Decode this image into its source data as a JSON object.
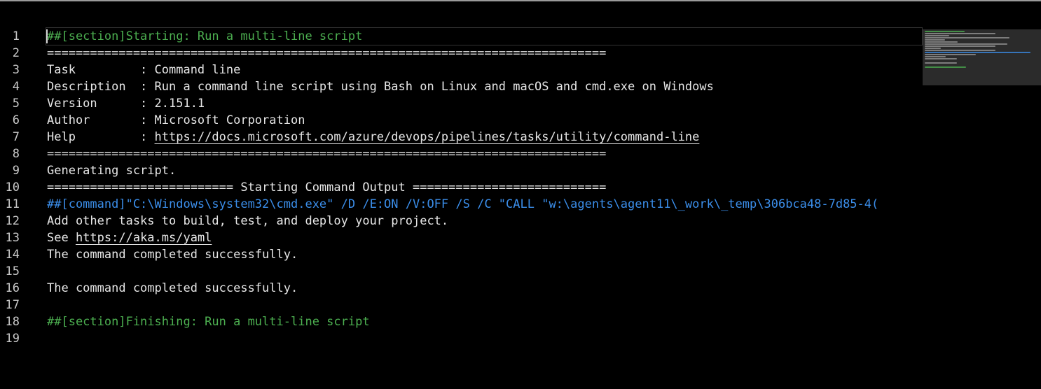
{
  "log": {
    "lines": [
      {
        "number": "1",
        "kind": "section",
        "text": "##[section]Starting: Run a multi-line script"
      },
      {
        "number": "2",
        "kind": "plain",
        "text": "=============================================================================="
      },
      {
        "number": "3",
        "kind": "plain",
        "text": "Task         : Command line"
      },
      {
        "number": "4",
        "kind": "plain",
        "text": "Description  : Run a command line script using Bash on Linux and macOS and cmd.exe on Windows"
      },
      {
        "number": "5",
        "kind": "plain",
        "text": "Version      : 2.151.1"
      },
      {
        "number": "6",
        "kind": "plain",
        "text": "Author       : Microsoft Corporation"
      },
      {
        "number": "7",
        "kind": "link-line",
        "prefix": "Help         : ",
        "link": "https://docs.microsoft.com/azure/devops/pipelines/tasks/utility/command-line"
      },
      {
        "number": "8",
        "kind": "plain",
        "text": "=============================================================================="
      },
      {
        "number": "9",
        "kind": "plain",
        "text": "Generating script."
      },
      {
        "number": "10",
        "kind": "plain",
        "text": "========================== Starting Command Output ==========================="
      },
      {
        "number": "11",
        "kind": "command",
        "text": "##[command]\"C:\\Windows\\system32\\cmd.exe\" /D /E:ON /V:OFF /S /C \"CALL \"w:\\agents\\agent11\\_work\\_temp\\306bca48-7d85-4("
      },
      {
        "number": "12",
        "kind": "plain",
        "text": "Add other tasks to build, test, and deploy your project."
      },
      {
        "number": "13",
        "kind": "link-line",
        "prefix": "See ",
        "link": "https://aka.ms/yaml"
      },
      {
        "number": "14",
        "kind": "plain",
        "text": "The command completed successfully."
      },
      {
        "number": "15",
        "kind": "plain",
        "text": ""
      },
      {
        "number": "16",
        "kind": "plain",
        "text": "The command completed successfully."
      },
      {
        "number": "17",
        "kind": "plain",
        "text": ""
      },
      {
        "number": "18",
        "kind": "section",
        "text": "##[section]Finishing: Run a multi-line script"
      },
      {
        "number": "19",
        "kind": "plain",
        "text": ""
      }
    ]
  },
  "colors": {
    "background": "#000000",
    "section": "#4caf50",
    "command": "#3b8eea",
    "text": "#e6e6e6",
    "gutter": "#c8c8c8",
    "minimap": "#2b2b2b"
  }
}
